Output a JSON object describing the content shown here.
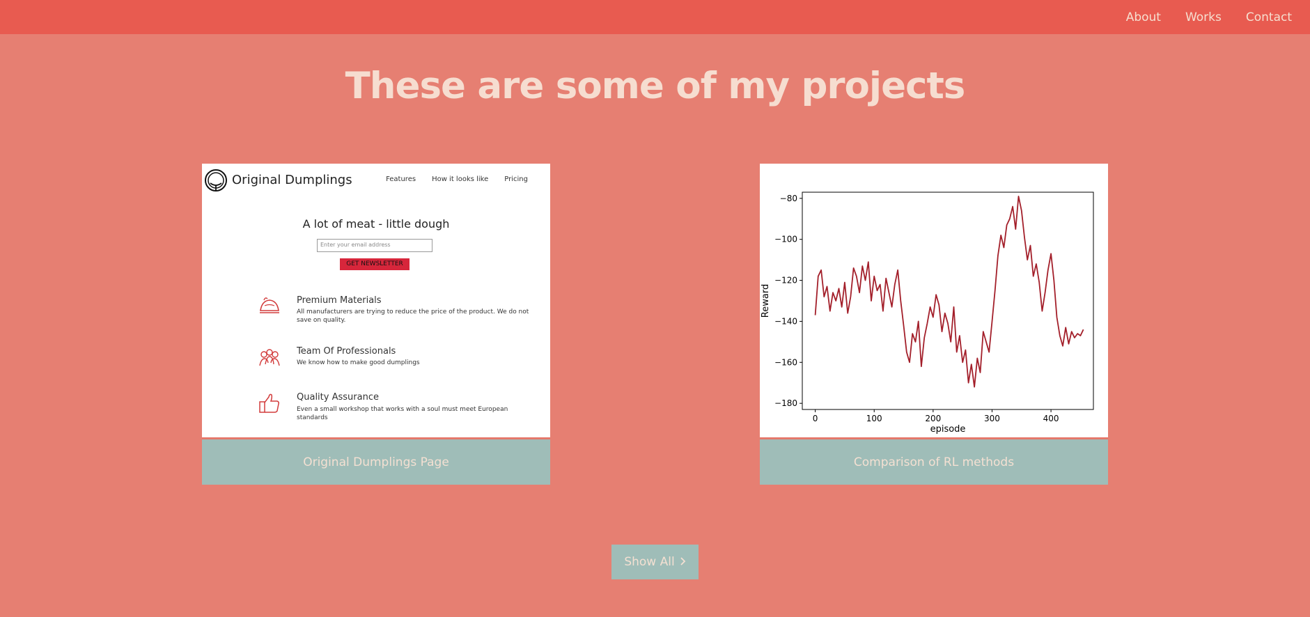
{
  "nav": {
    "about": "About",
    "works": "Works",
    "contact": "Contact"
  },
  "heading": "These are some of my projects",
  "projects": [
    {
      "caption": "Original Dumplings Page",
      "thumb": {
        "brand": "Original Dumplings",
        "nav": [
          "Features",
          "How it looks like",
          "Pricing"
        ],
        "title": "A lot of meat - little dough",
        "email_placeholder": "Enter your email address",
        "button": "GET NEWSLETTER",
        "features": [
          {
            "icon": "dumpling-icon",
            "title": "Premium Materials",
            "desc": "All manufacturers are trying to reduce the price of the product. We do not save on quality."
          },
          {
            "icon": "team-icon",
            "title": "Team Of Professionals",
            "desc": "We know how to make good dumplings"
          },
          {
            "icon": "thumbs-up-icon",
            "title": "Quality Assurance",
            "desc": "Even a small workshop that works with a soul must meet European standards"
          }
        ]
      }
    },
    {
      "caption": "Comparison of RL methods"
    }
  ],
  "show_all": "Show All",
  "show_all_icon": "chevron-right-icon",
  "colors": {
    "topbar": "#e85b50",
    "background": "#e67f72",
    "caption_bg": "#9fbdb8",
    "text_light": "#f6ddd0",
    "line": "#a31f2a"
  },
  "chart_data": {
    "type": "line",
    "xlabel": "episode",
    "ylabel": "Reward",
    "xlim": [
      -22,
      472
    ],
    "ylim": [
      -183,
      -77
    ],
    "xticks": [
      0,
      100,
      200,
      300,
      400
    ],
    "yticks": [
      -80,
      -100,
      -120,
      -140,
      -160,
      -180
    ],
    "grid": false,
    "series": [
      {
        "x": [
          0,
          5,
          10,
          15,
          20,
          25,
          30,
          35,
          40,
          45,
          50,
          55,
          60,
          65,
          70,
          75,
          80,
          85,
          90,
          95,
          100,
          105,
          110,
          115,
          120,
          125,
          130,
          135,
          140,
          145,
          150,
          155,
          160,
          165,
          170,
          175,
          180,
          185,
          190,
          195,
          200,
          205,
          210,
          215,
          220,
          225,
          230,
          235,
          240,
          245,
          250,
          255,
          260,
          265,
          270,
          275,
          280,
          285,
          290,
          295,
          300,
          305,
          310,
          315,
          320,
          325,
          330,
          335,
          340,
          345,
          350,
          355,
          360,
          365,
          370,
          375,
          380,
          385,
          390,
          395,
          400,
          405,
          410,
          415,
          420,
          425,
          430,
          435,
          440,
          445,
          450,
          455
        ],
        "y": [
          -137,
          -118,
          -115,
          -128,
          -123,
          -135,
          -126,
          -130,
          -124,
          -133,
          -121,
          -136,
          -128,
          -114,
          -118,
          -126,
          -113,
          -120,
          -111,
          -130,
          -118,
          -125,
          -122,
          -135,
          -119,
          -126,
          -133,
          -122,
          -115,
          -130,
          -142,
          -155,
          -160,
          -146,
          -150,
          -140,
          -162,
          -148,
          -141,
          -133,
          -138,
          -127,
          -132,
          -145,
          -136,
          -141,
          -150,
          -133,
          -155,
          -147,
          -160,
          -154,
          -170,
          -161,
          -172,
          -158,
          -165,
          -145,
          -150,
          -155,
          -140,
          -125,
          -108,
          -98,
          -104,
          -93,
          -90,
          -84,
          -95,
          -79,
          -86,
          -99,
          -110,
          -103,
          -118,
          -112,
          -121,
          -135,
          -126,
          -115,
          -107,
          -120,
          -138,
          -147,
          -152,
          -143,
          -151,
          -145,
          -148,
          -146,
          -147,
          -144
        ]
      }
    ]
  }
}
